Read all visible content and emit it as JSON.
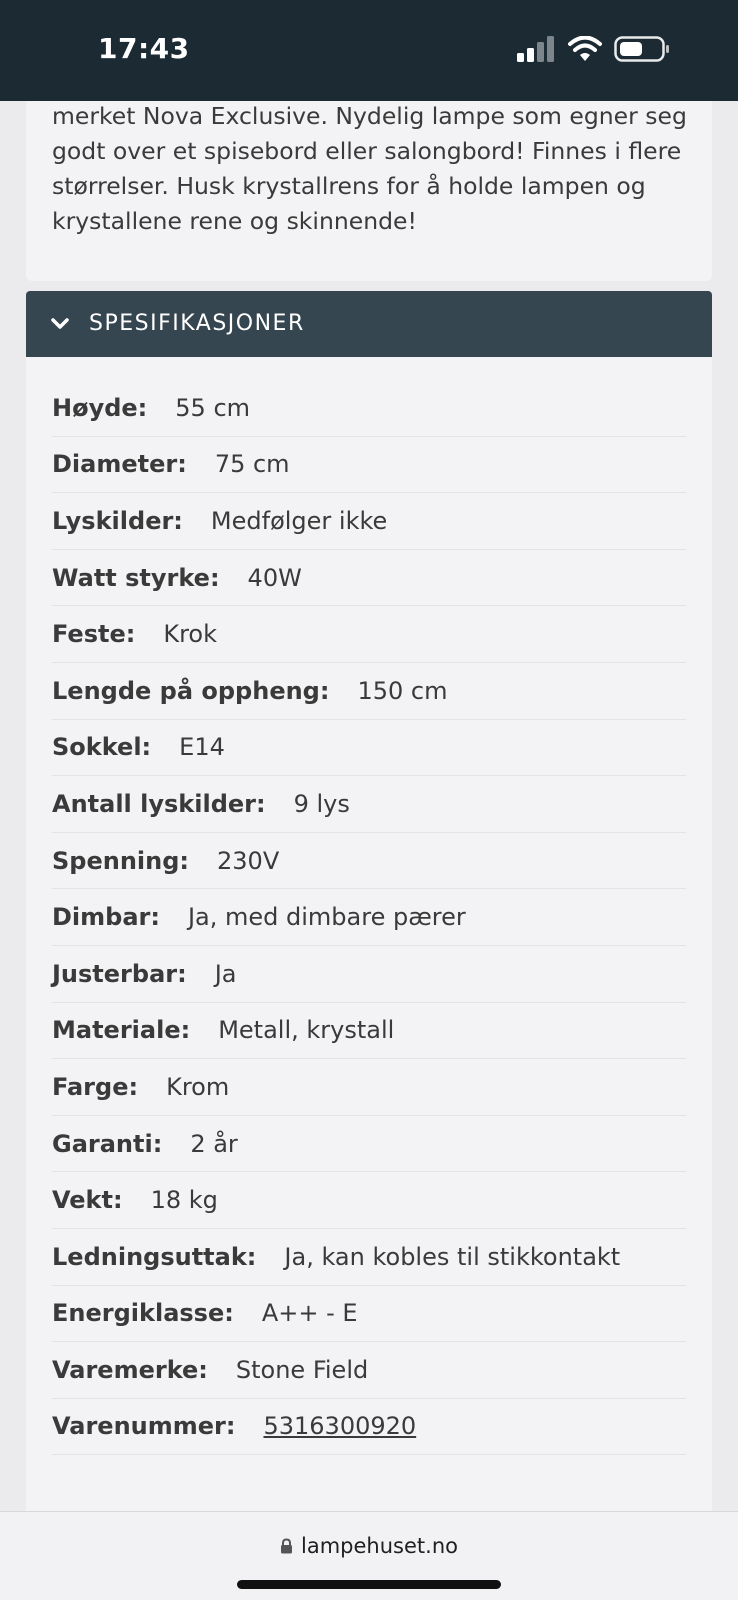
{
  "status_bar": {
    "time": "17:43",
    "icons": [
      "signal-icon",
      "wifi-icon",
      "battery-icon"
    ]
  },
  "description": {
    "text": "merket Nova Exclusive. Nydelig lampe som egner seg godt over et spisebord eller salongbord! Finnes i flere størrelser. Husk krystallrens for å holde lampen og krystallene rene og skinnende!"
  },
  "specs": {
    "title": "SPESIFIKASJONER",
    "rows": [
      {
        "label": "Høyde:",
        "value": "55 cm"
      },
      {
        "label": "Diameter:",
        "value": "75 cm"
      },
      {
        "label": "Lyskilder:",
        "value": "Medfølger ikke"
      },
      {
        "label": "Watt styrke:",
        "value": "40W"
      },
      {
        "label": "Feste:",
        "value": "Krok"
      },
      {
        "label": "Lengde på oppheng:",
        "value": "150 cm"
      },
      {
        "label": "Sokkel:",
        "value": "E14"
      },
      {
        "label": "Antall lyskilder:",
        "value": "9 lys"
      },
      {
        "label": "Spenning:",
        "value": "230V"
      },
      {
        "label": "Dimbar:",
        "value": "Ja, med dimbare pærer"
      },
      {
        "label": "Justerbar:",
        "value": "Ja"
      },
      {
        "label": "Materiale:",
        "value": "Metall, krystall"
      },
      {
        "label": "Farge:",
        "value": "Krom"
      },
      {
        "label": "Garanti:",
        "value": "2 år"
      },
      {
        "label": "Vekt:",
        "value": "18 kg"
      },
      {
        "label": "Ledningsuttak:",
        "value": "Ja, kan kobles til stikkontakt"
      },
      {
        "label": "Energiklasse:",
        "value": "A++ - E"
      },
      {
        "label": "Varemerke:",
        "value": "Stone Field"
      },
      {
        "label": "Varenummer:",
        "value": "5316300920"
      }
    ]
  },
  "browser": {
    "url": "lampehuset.no"
  },
  "colors": {
    "status_bar_bg": "#1b2a33",
    "spec_header_bg": "#364650",
    "card_bg": "#f3f3f5",
    "text": "#3a3a3a"
  }
}
